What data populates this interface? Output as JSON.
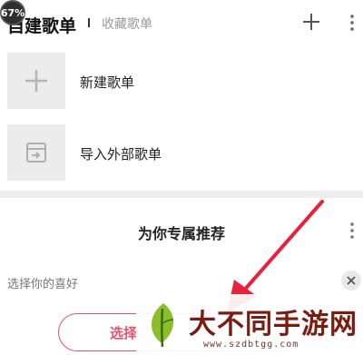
{
  "status": {
    "battery_badge": "67%"
  },
  "header": {
    "tab_active": "自建歌单",
    "tab_inactive": "收藏歌单",
    "add_icon": "plus-icon",
    "more_icon": "more-vertical-icon"
  },
  "playlist_rows": [
    {
      "label": "新建歌单",
      "icon": "plus-icon"
    },
    {
      "label": "导入外部歌单",
      "icon": "import-icon"
    }
  ],
  "recommend": {
    "title": "为你专属推荐",
    "preference_label": "选择你的喜好",
    "select_button": "选择",
    "close_icon": "close-icon",
    "more_icon": "more-vertical-icon"
  },
  "watermark": {
    "title": "大不同手游网",
    "url": "www.szdbtgg.com"
  },
  "colors": {
    "accent": "#e8516b",
    "arrow": "#e8223a",
    "watermark": "#7a1c10"
  }
}
